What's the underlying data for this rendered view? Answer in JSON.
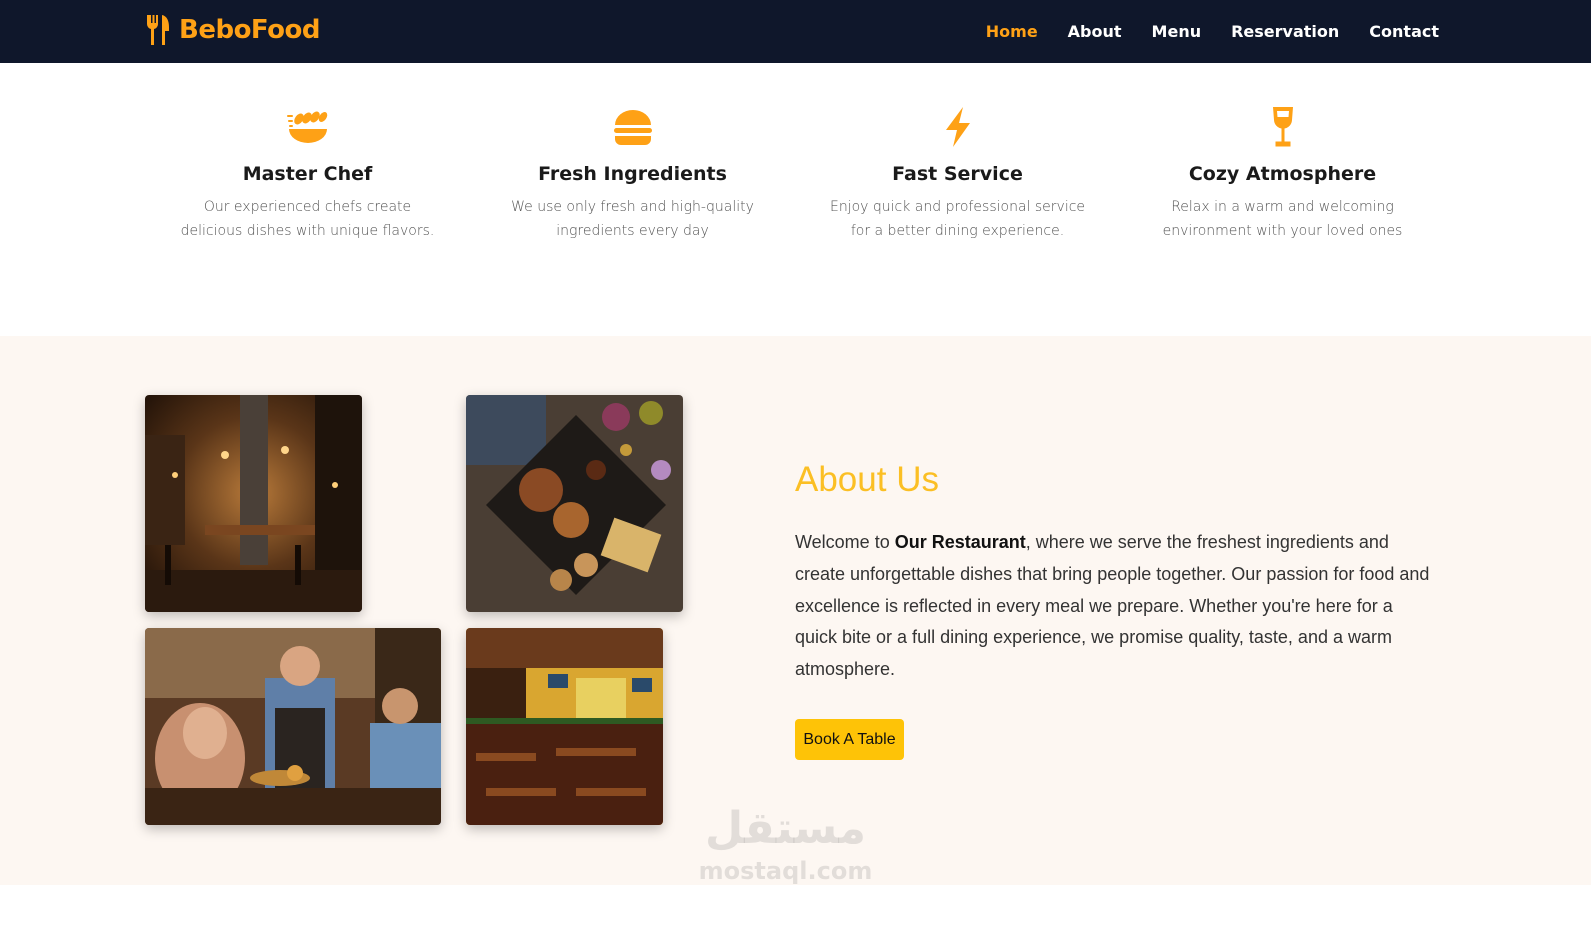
{
  "brand": {
    "name": "BeboFood",
    "icon": "utensils-icon",
    "color": "#fea116"
  },
  "nav": {
    "items": [
      {
        "label": "Home",
        "active": true
      },
      {
        "label": "About",
        "active": false
      },
      {
        "label": "Menu",
        "active": false
      },
      {
        "label": "Reservation",
        "active": false
      },
      {
        "label": "Contact",
        "active": false
      }
    ]
  },
  "features": [
    {
      "icon": "chef-bread-icon",
      "title": "Master Chef",
      "description": "Our experienced chefs create delicious dishes with unique flavors."
    },
    {
      "icon": "hamburger-icon",
      "title": "Fresh Ingredients",
      "description": "We use only fresh and high-quality ingredients every day"
    },
    {
      "icon": "lightning-bolt-icon",
      "title": "Fast Service",
      "description": "Enjoy quick and professional service for a better dining experience."
    },
    {
      "icon": "wine-glass-icon",
      "title": "Cozy Atmosphere",
      "description": "Relax in a warm and welcoming environment with your loved ones"
    }
  ],
  "about": {
    "title": "About Us",
    "text_before": "Welcome to ",
    "text_bold": "Our Restaurant",
    "text_after": ", where we serve the freshest ingredients and create unforgettable dishes that bring people together. Our passion for food and excellence is reflected in every meal we prepare. Whether you're here for a quick bite or a full dining experience, we promise quality, taste, and a warm atmosphere.",
    "button_label": "Book A Table",
    "images": [
      {
        "icon": "restaurant-interior-photo"
      },
      {
        "icon": "food-platter-photo"
      },
      {
        "icon": "waiter-serving-photo"
      },
      {
        "icon": "dining-hall-photo"
      }
    ]
  },
  "watermark": {
    "arabic": "مستقل",
    "latin": "mostaql.com"
  },
  "colors": {
    "navbar": "#0f172b",
    "accent": "#fea116",
    "title_yellow": "#fbbf24",
    "button": "#fec307",
    "about_bg": "#fdf7f2"
  }
}
